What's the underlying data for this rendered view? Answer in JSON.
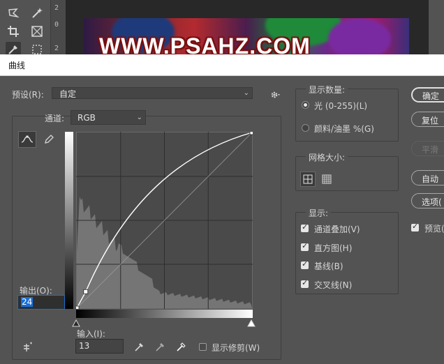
{
  "photoshop": {
    "ruler_numbers": [
      "2",
      "0",
      "2"
    ],
    "document_text": "WWW.PSAHZ.COM",
    "tools": [
      "lasso-icon",
      "magic-wand-icon",
      "crop-icon",
      "frame-icon",
      "eyedropper-icon",
      "patch-icon"
    ]
  },
  "dialog": {
    "title": "曲线",
    "preset_label": "预设(R):",
    "preset_value": "自定",
    "channel_label": "通道:",
    "channel_value": "RGB",
    "output_label": "输出(O):",
    "output_value": "24",
    "input_label": "输入(I):",
    "input_value": "13",
    "show_clipping_label": "显示修剪(W)",
    "show_amount": {
      "title": "显示数量:",
      "light": "光 (0-255)(L)",
      "pigment": "颜料/油墨 %(G)",
      "selected": "light"
    },
    "grid_size": {
      "title": "网格大小:",
      "selected": "large"
    },
    "show": {
      "title": "显示:",
      "options": [
        {
          "label": "通道叠加(V)",
          "checked": true
        },
        {
          "label": "直方图(H)",
          "checked": true
        },
        {
          "label": "基线(B)",
          "checked": true
        },
        {
          "label": "交叉线(N)",
          "checked": true
        }
      ]
    },
    "buttons": {
      "ok": "确定",
      "reset": "复位",
      "smooth": "平滑",
      "auto": "自动",
      "options": "选项(",
      "preview": "预览("
    },
    "preview_checked": true
  },
  "chart_data": {
    "type": "line",
    "title": "",
    "xlabel": "输入(I):",
    "ylabel": "输出(O):",
    "xlim": [
      0,
      255
    ],
    "ylim": [
      0,
      255
    ],
    "grid": true,
    "curve_points": [
      [
        0,
        0
      ],
      [
        13,
        24
      ],
      [
        255,
        255
      ]
    ],
    "histogram_color": "#7a7a7a",
    "curve_color": "#ffffff"
  }
}
